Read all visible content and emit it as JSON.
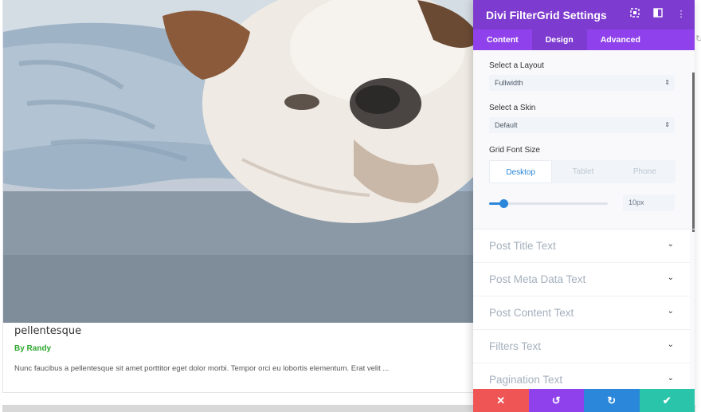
{
  "post": {
    "title": "pellentesque",
    "author": "By Randy",
    "excerpt": "Nunc faucibus a pellentesque sit amet porttitor eget dolor morbi. Tempor orci eu lobortis elementum. Erat velit ..."
  },
  "panel": {
    "title": "Divi FilterGrid Settings",
    "tabs": [
      {
        "label": "Content"
      },
      {
        "label": "Design"
      },
      {
        "label": "Advanced"
      }
    ],
    "active_tab": "Design",
    "layout": {
      "label": "Select a Layout",
      "value": "Fullwidth"
    },
    "skin": {
      "label": "Select a Skin",
      "value": "Default"
    },
    "font_size": {
      "label": "Grid Font Size",
      "devices": [
        "Desktop",
        "Tablet",
        "Phone"
      ],
      "active_device": "Desktop",
      "value": "10px",
      "slider_fraction": 0.12
    },
    "toggles": [
      {
        "label": "Post Title Text"
      },
      {
        "label": "Post Meta Data Text"
      },
      {
        "label": "Post Content Text"
      },
      {
        "label": "Filters Text"
      },
      {
        "label": "Pagination Text"
      }
    ],
    "icons": {
      "header": [
        "fullscreen-icon",
        "split-view-icon",
        "more-options-icon"
      ],
      "select_arrow": "updown-arrow-icon",
      "toggle_chevron": "chevron-down-icon",
      "footer": [
        "close-icon",
        "undo-icon",
        "redo-icon",
        "check-icon"
      ]
    },
    "colors": {
      "header": "#7e3bd0",
      "tabs": "#8f42ec",
      "accent": "#2b87da",
      "close": "#ef5555",
      "undo": "#8f42ec",
      "redo": "#2b87da",
      "save": "#29c4a9",
      "author": "#2fa82f"
    }
  }
}
